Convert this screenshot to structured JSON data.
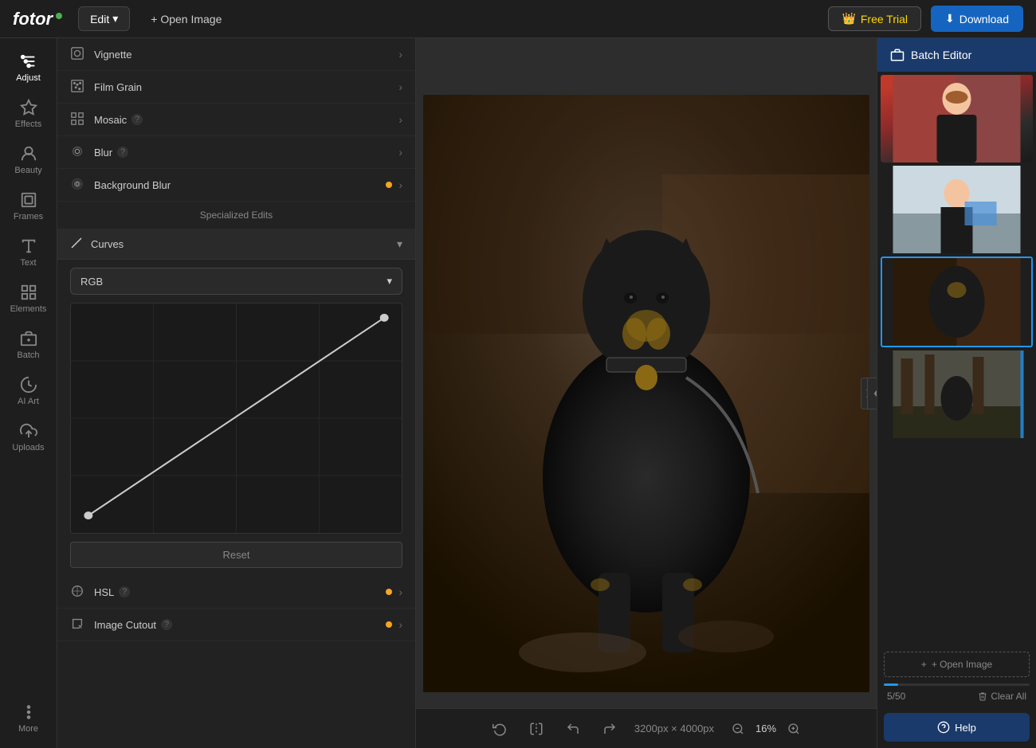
{
  "topbar": {
    "logo": "fotor",
    "edit_label": "Edit",
    "open_image_label": "+ Open Image",
    "free_trial_label": "Free Trial",
    "download_label": "Download"
  },
  "sidebar": {
    "items": [
      {
        "id": "adjust",
        "label": "Adjust",
        "icon": "sliders"
      },
      {
        "id": "effects",
        "label": "Effects",
        "icon": "sparkle"
      },
      {
        "id": "beauty",
        "label": "Beauty",
        "icon": "face"
      },
      {
        "id": "frames",
        "label": "Frames",
        "icon": "frame"
      },
      {
        "id": "text",
        "label": "Text",
        "icon": "text"
      },
      {
        "id": "elements",
        "label": "Elements",
        "icon": "grid"
      },
      {
        "id": "batch",
        "label": "Batch",
        "icon": "batch"
      },
      {
        "id": "ai_art",
        "label": "AI Art",
        "icon": "ai"
      },
      {
        "id": "uploads",
        "label": "Uploads",
        "icon": "upload"
      },
      {
        "id": "more",
        "label": "More",
        "icon": "more"
      }
    ]
  },
  "panel": {
    "items": [
      {
        "id": "vignette",
        "label": "Vignette",
        "has_arrow": true,
        "has_dot": false
      },
      {
        "id": "film_grain",
        "label": "Film Grain",
        "has_arrow": true,
        "has_dot": false
      },
      {
        "id": "mosaic",
        "label": "Mosaic",
        "has_question": true,
        "has_arrow": true,
        "has_dot": false
      },
      {
        "id": "blur",
        "label": "Blur",
        "has_question": true,
        "has_arrow": true,
        "has_dot": false
      },
      {
        "id": "background_blur",
        "label": "Background Blur",
        "has_arrow": true,
        "has_dot": true
      }
    ],
    "specialized_edits_label": "Specialized Edits",
    "curves": {
      "label": "Curves",
      "channel": "RGB",
      "reset_label": "Reset"
    },
    "hsl": {
      "label": "HSL",
      "has_question": true,
      "has_dot": true,
      "has_arrow": true
    },
    "image_cutout": {
      "label": "Image Cutout",
      "has_question": true,
      "has_dot": true,
      "has_arrow": true
    }
  },
  "canvas": {
    "image_size": "3200px × 4000px",
    "zoom_level": "16%"
  },
  "right_panel": {
    "title": "Batch Editor",
    "open_image_label": "+ Open Image",
    "counter": "5/50",
    "clear_all_label": "Clear All",
    "help_label": "Help",
    "progress_percent": 10
  }
}
